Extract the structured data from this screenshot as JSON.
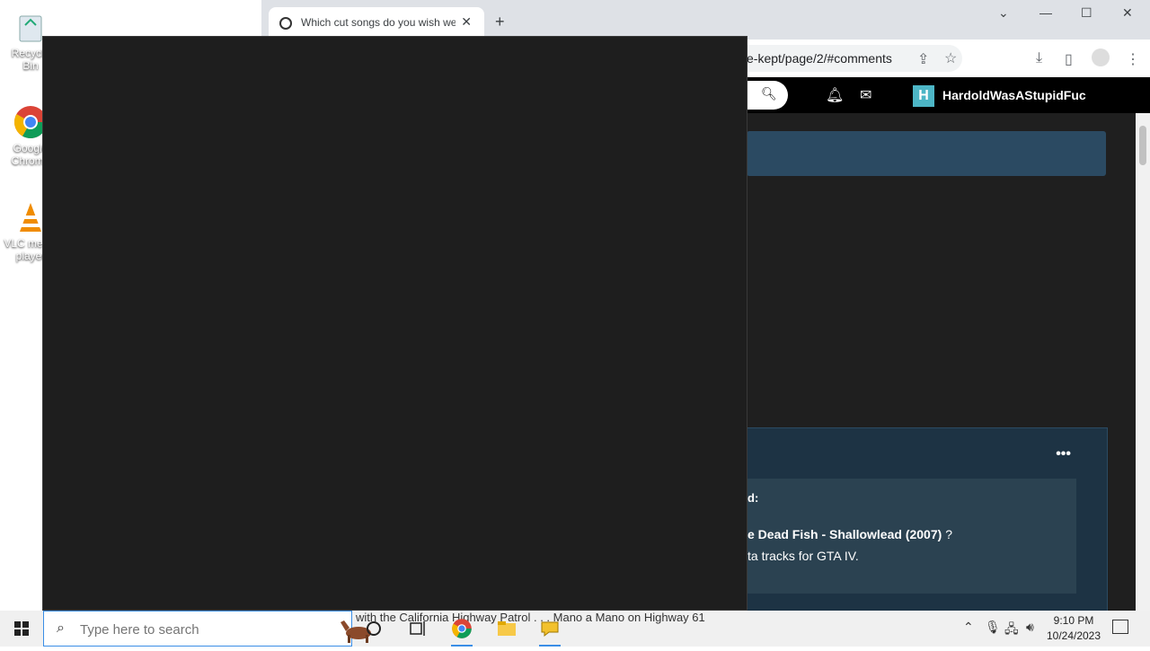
{
  "desktop": {
    "icons": [
      {
        "label": "Recycle Bin",
        "icon": "recycle-bin-icon"
      },
      {
        "label": "Google Chrome",
        "icon": "chrome-icon"
      },
      {
        "label": "VLC media player",
        "icon": "vlc-icon"
      }
    ]
  },
  "browser": {
    "tab_title": "Which cut songs do you wish we",
    "close_tab": "✕",
    "new_tab": "+",
    "url": "e-kept/page/2/#comments",
    "window_controls": {
      "minimize": "—",
      "maximize": "☐",
      "close": "✕",
      "tab_search": "⌄"
    }
  },
  "site": {
    "username": "HardoldWasAStupidFuc",
    "avatar_letter": "H",
    "post_menu": "•••",
    "quote_said": "d:",
    "quote_song": "e Dead Fish - Shallowlead (2007)",
    "quote_question": "?",
    "quote_tracks": "ta tracks for GTA IV."
  },
  "taskbar": {
    "search_placeholder": "Type here to search",
    "ticker": "with the California Highway Patrol . . . Mano a Mano on Highway 61",
    "time": "9:10 PM",
    "date": "10/24/2023"
  },
  "colors": {
    "accent": "#4db6c6",
    "page_bg": "#1f1f1f",
    "banner": "#2b4a62",
    "taskbar": "#f0f0f0"
  }
}
